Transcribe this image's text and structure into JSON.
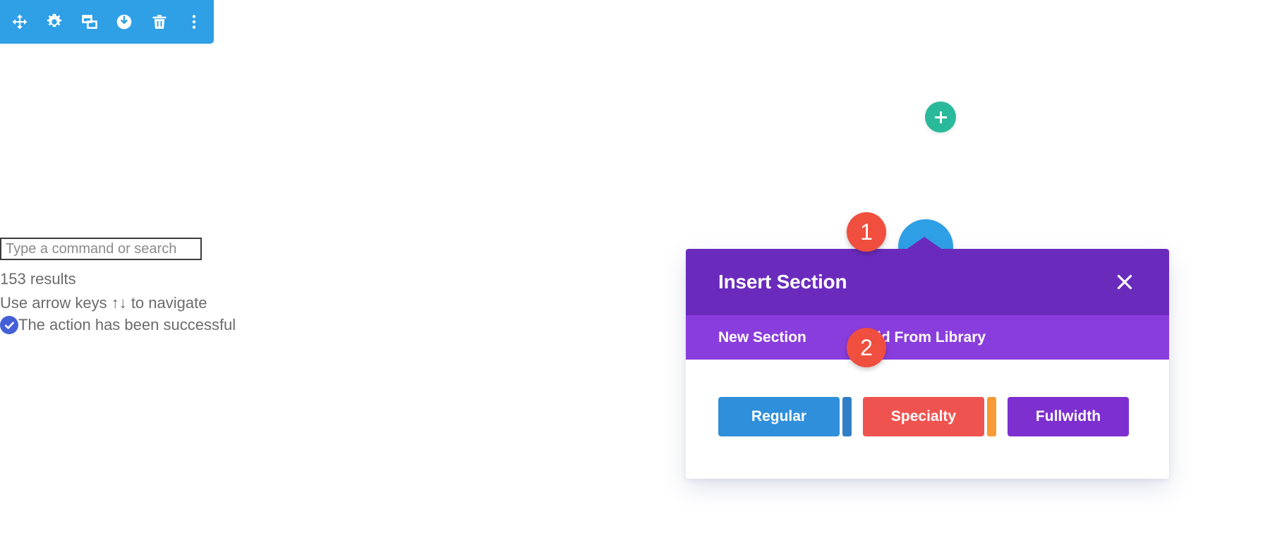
{
  "element_toolbar": {
    "name": "element-settings-toolbar",
    "bg_color": "#2f9fe6",
    "buttons": [
      {
        "icon": "move-icon",
        "label": "Move"
      },
      {
        "icon": "gear-icon",
        "label": "Settings"
      },
      {
        "icon": "duplicate-icon",
        "label": "Duplicate"
      },
      {
        "icon": "power-icon",
        "label": "Disable"
      },
      {
        "icon": "trash-icon",
        "label": "Delete"
      },
      {
        "icon": "ellipsis-vertical-icon",
        "label": "More Options"
      }
    ]
  },
  "left_panel": {
    "search": {
      "placeholder": "Type a command or search",
      "value": ""
    },
    "results_count": "153 results",
    "navigation_hint": "Use arrow keys ↑↓ to navigate",
    "success_message": "The action has been successful",
    "success_icon": "circle-check-icon",
    "success_icon_color": "#4560d7"
  },
  "canvas": {
    "add_module_button": {
      "icon": "plus-icon",
      "color": "#2bb99b",
      "label": "Add New Module"
    },
    "add_section_button": {
      "icon": "plus-icon",
      "color": "#2f9fe6",
      "label": "Add New Section"
    }
  },
  "step_badges": [
    {
      "number": "1"
    },
    {
      "number": "2"
    }
  ],
  "modal": {
    "title": "Insert Section",
    "close_icon": "close-icon",
    "header_color": "#6a2bbd",
    "tabs_color": "#8a3ddd",
    "tabs": [
      {
        "label": "New Section",
        "active": true
      },
      {
        "label": "Add From Library",
        "active": false
      }
    ],
    "section_types": [
      {
        "label": "Regular",
        "color": "#2f8fdb",
        "bar_color": "#2f7fc8"
      },
      {
        "label": "Specialty",
        "color": "#ef5350",
        "bar_color": "#f89a35"
      },
      {
        "label": "Fullwidth",
        "color": "#7e2fd0",
        "bar_color": ""
      }
    ]
  }
}
